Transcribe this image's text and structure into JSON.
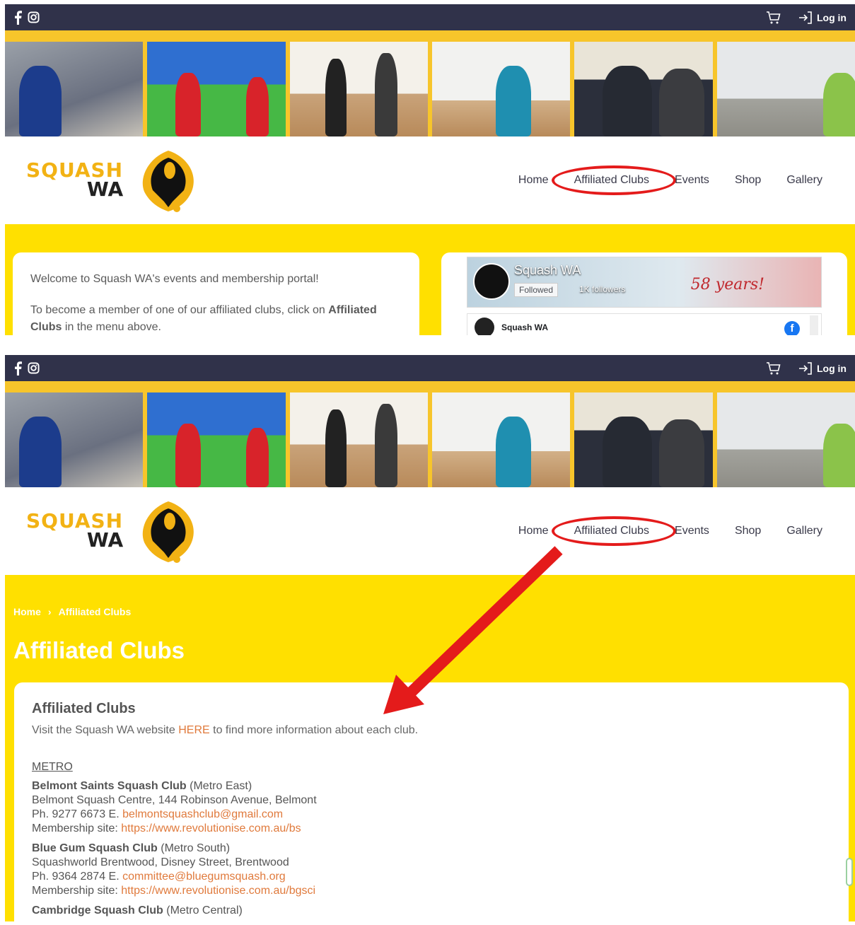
{
  "topbar": {
    "login_label": "Log in"
  },
  "nav": {
    "items": [
      "Home",
      "Affiliated Clubs",
      "Events",
      "Shop",
      "Gallery"
    ]
  },
  "logo": {
    "line1": "SQUASH",
    "line2": "WA"
  },
  "home_panel": {
    "welcome": "Welcome to Squash WA's events and membership portal!",
    "become_prefix": "To become a member of one of our affiliated clubs, click on",
    "become_bold": "Affiliated Clubs",
    "become_suffix": "in the menu above."
  },
  "facebook": {
    "page_name": "Squash WA",
    "followed_label": "Followed",
    "followers": "1K followers",
    "cover_text": "58 years!",
    "post_author": "Squash WA"
  },
  "breadcrumb": {
    "home": "Home",
    "current": "Affiliated Clubs"
  },
  "page_title": "Affiliated Clubs",
  "clubs_section": {
    "heading": "Affiliated Clubs",
    "intro_prefix": "Visit the Squash WA website",
    "intro_link": "HERE",
    "intro_suffix": "to find more information about each club.",
    "region": "METRO",
    "clubs": [
      {
        "name": "Belmont Saints Squash Club",
        "area": "(Metro East)",
        "address": "Belmont Squash Centre, 144 Robinson Avenue, Belmont",
        "phone": "Ph. 9277 6673 E.",
        "email": "belmontsquashclub@gmail.com",
        "site_label": "Membership site:",
        "site": "https://www.revolutionise.com.au/bs"
      },
      {
        "name": "Blue Gum Squash Club",
        "area": "(Metro South)",
        "address": "Squashworld Brentwood, Disney Street, Brentwood",
        "phone": "Ph. 9364 2874 E.",
        "email": "committee@bluegumsquash.org",
        "site_label": "Membership site:",
        "site": "https://www.revolutionise.com.au/bgsci"
      },
      {
        "name": "Cambridge Squash Club",
        "area": "(Metro Central)"
      }
    ]
  },
  "colors": {
    "topbar": "#30324a",
    "yellow": "#ffe000",
    "link": "#e07a3c",
    "annotation_red": "#e41b1b"
  }
}
